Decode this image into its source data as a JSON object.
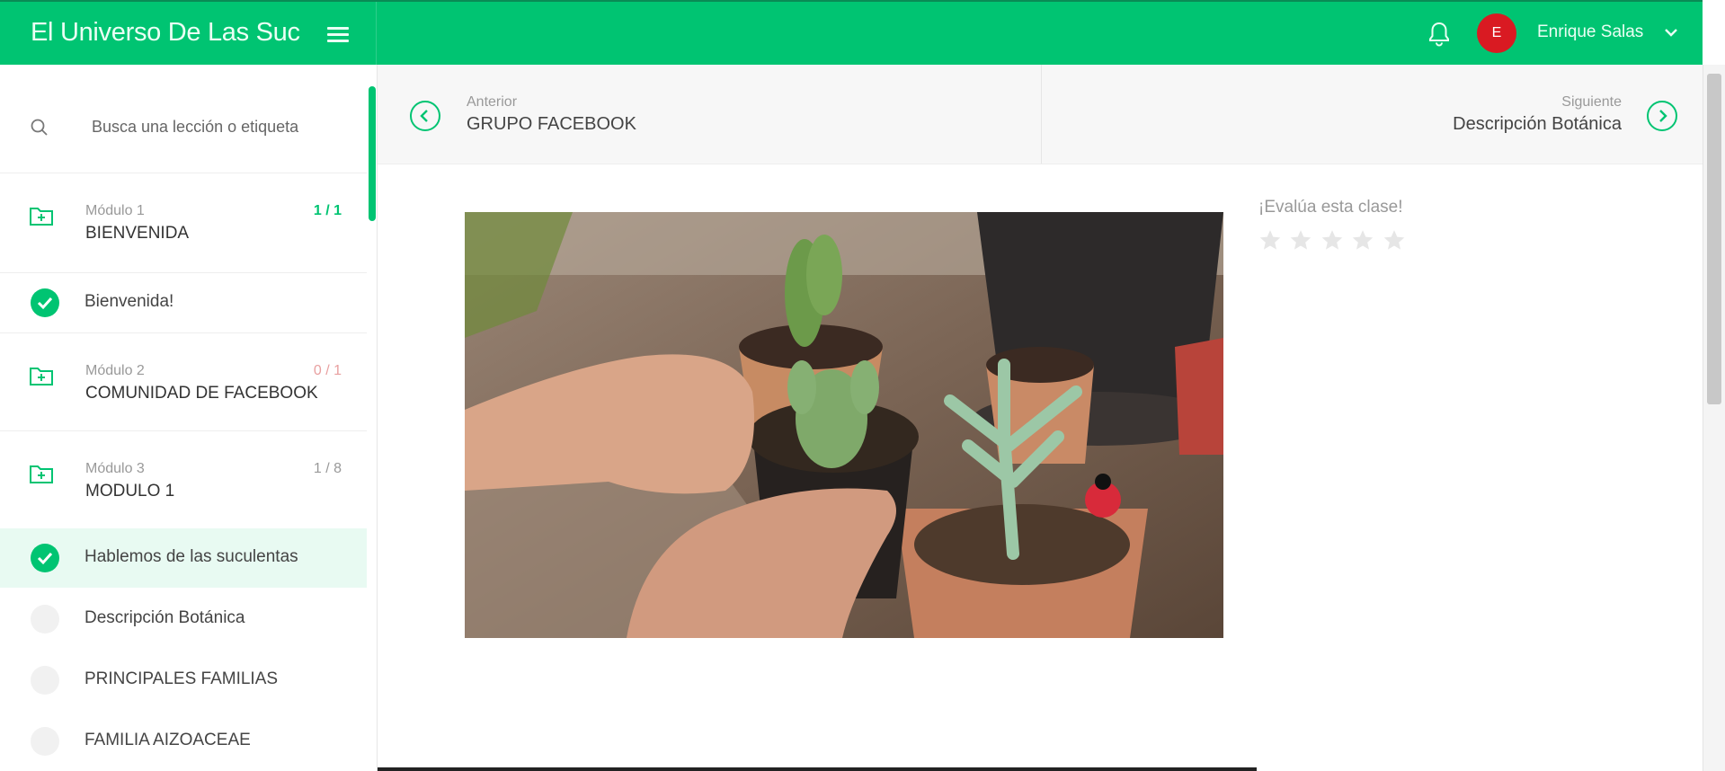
{
  "header": {
    "title": "El Universo De Las Suc",
    "user_name": "Enrique Salas",
    "avatar_initial": "E",
    "accent_color": "#00c472"
  },
  "sidebar": {
    "search_placeholder": "Busca una lección o etiqueta",
    "modules": [
      {
        "label": "Módulo 1",
        "title": "BIENVENIDA",
        "count": "1 / 1",
        "completed": true
      },
      {
        "label": "Módulo 2",
        "title": "COMUNIDAD DE FACEBOOK",
        "count": "0 / 1",
        "completed": false
      },
      {
        "label": "Módulo 3",
        "title": "MODULO 1",
        "count": "1 / 8",
        "completed": false
      }
    ],
    "lessons": [
      {
        "title": "Bienvenida!",
        "done": true
      },
      {
        "title": "Hablemos de las suculentas",
        "done": true,
        "active": true
      },
      {
        "title": "Descripción Botánica",
        "done": false
      },
      {
        "title": "PRINCIPALES FAMILIAS",
        "done": false
      },
      {
        "title": "FAMILIA AIZOACEAE",
        "done": false
      }
    ]
  },
  "lesson_nav": {
    "prev_label": "Anterior",
    "prev_title": "GRUPO FACEBOOK",
    "next_label": "Siguiente",
    "next_title": "Descripción Botánica"
  },
  "rating": {
    "prompt": "¡Evalúa esta clase!",
    "max_stars": 5,
    "value": 0
  },
  "icons": [
    "menu-icon",
    "bell-icon",
    "chevron-down-icon",
    "search-icon",
    "folder-plus-icon",
    "check-icon",
    "chevron-left-icon",
    "chevron-right-icon",
    "star-icon"
  ]
}
